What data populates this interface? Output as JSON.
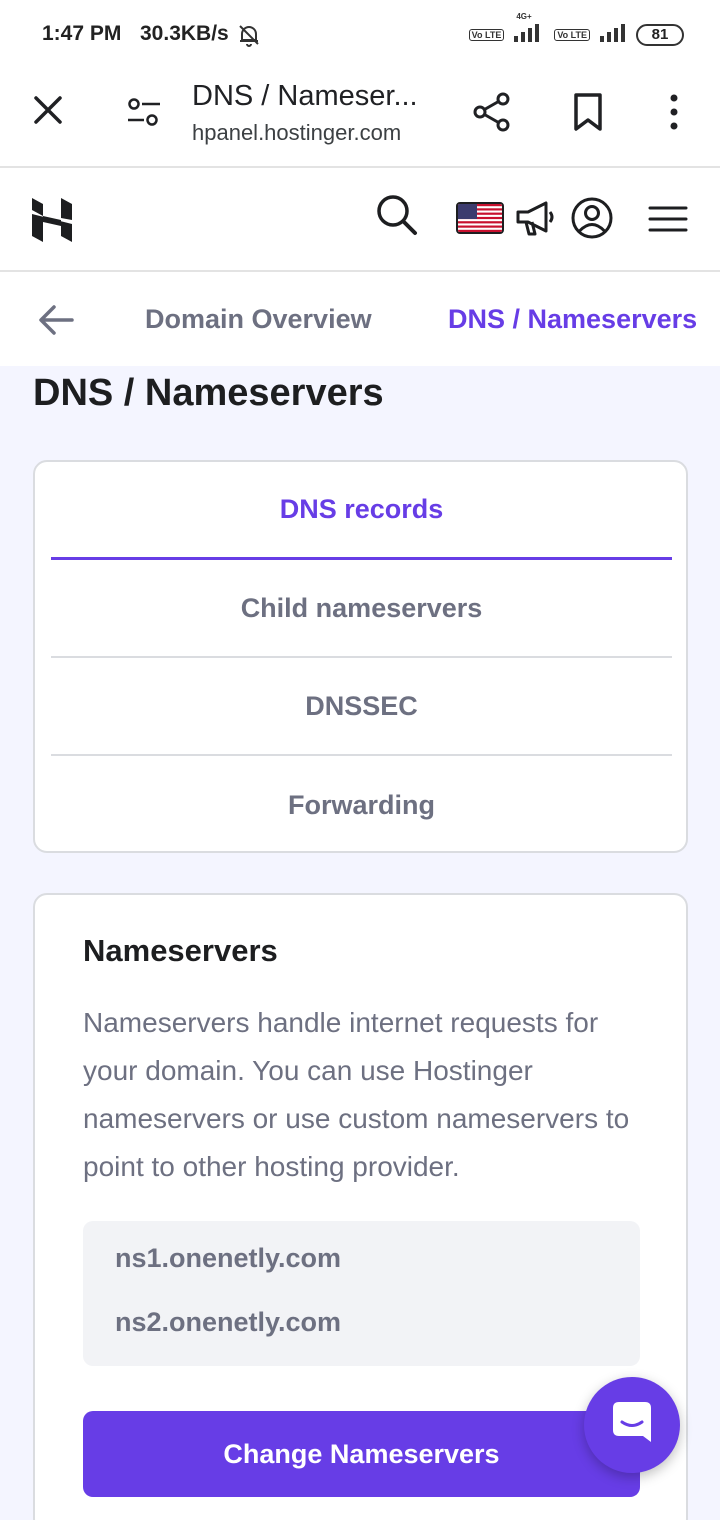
{
  "status_bar": {
    "time": "1:47 PM",
    "speed": "30.3KB/s",
    "network_label": "4G+",
    "volte_1": "Vo LTE",
    "volte_2": "Vo LTE",
    "battery": "81"
  },
  "browser": {
    "title": "DNS / Nameser...",
    "url": "hpanel.hostinger.com"
  },
  "header": {
    "logo_icon": "hostinger-logo",
    "icons": [
      "search-icon",
      "us-flag-icon",
      "megaphone-icon",
      "user-icon",
      "menu-icon"
    ]
  },
  "breadcrumb": {
    "back_icon": "arrow-left-icon",
    "items": [
      {
        "label": "Domain Overview"
      },
      {
        "label": "DNS / Nameservers"
      }
    ]
  },
  "page": {
    "title": "DNS / Nameservers"
  },
  "tabs": [
    {
      "label": "DNS records",
      "active": true
    },
    {
      "label": "Child nameservers",
      "active": false
    },
    {
      "label": "DNSSEC",
      "active": false
    },
    {
      "label": "Forwarding",
      "active": false
    }
  ],
  "nameservers": {
    "title": "Nameservers",
    "description": "Nameservers handle internet requests for your domain. You can use Hostinger nameservers or use custom nameservers to point to other hosting provider.",
    "items": [
      "ns1.onenetly.com",
      "ns2.onenetly.com"
    ],
    "button_label": "Change Nameservers"
  },
  "colors": {
    "accent": "#673de6",
    "muted_text": "#6d7081",
    "page_bg": "#f4f5ff"
  },
  "chat": {
    "icon": "chat-icon"
  }
}
